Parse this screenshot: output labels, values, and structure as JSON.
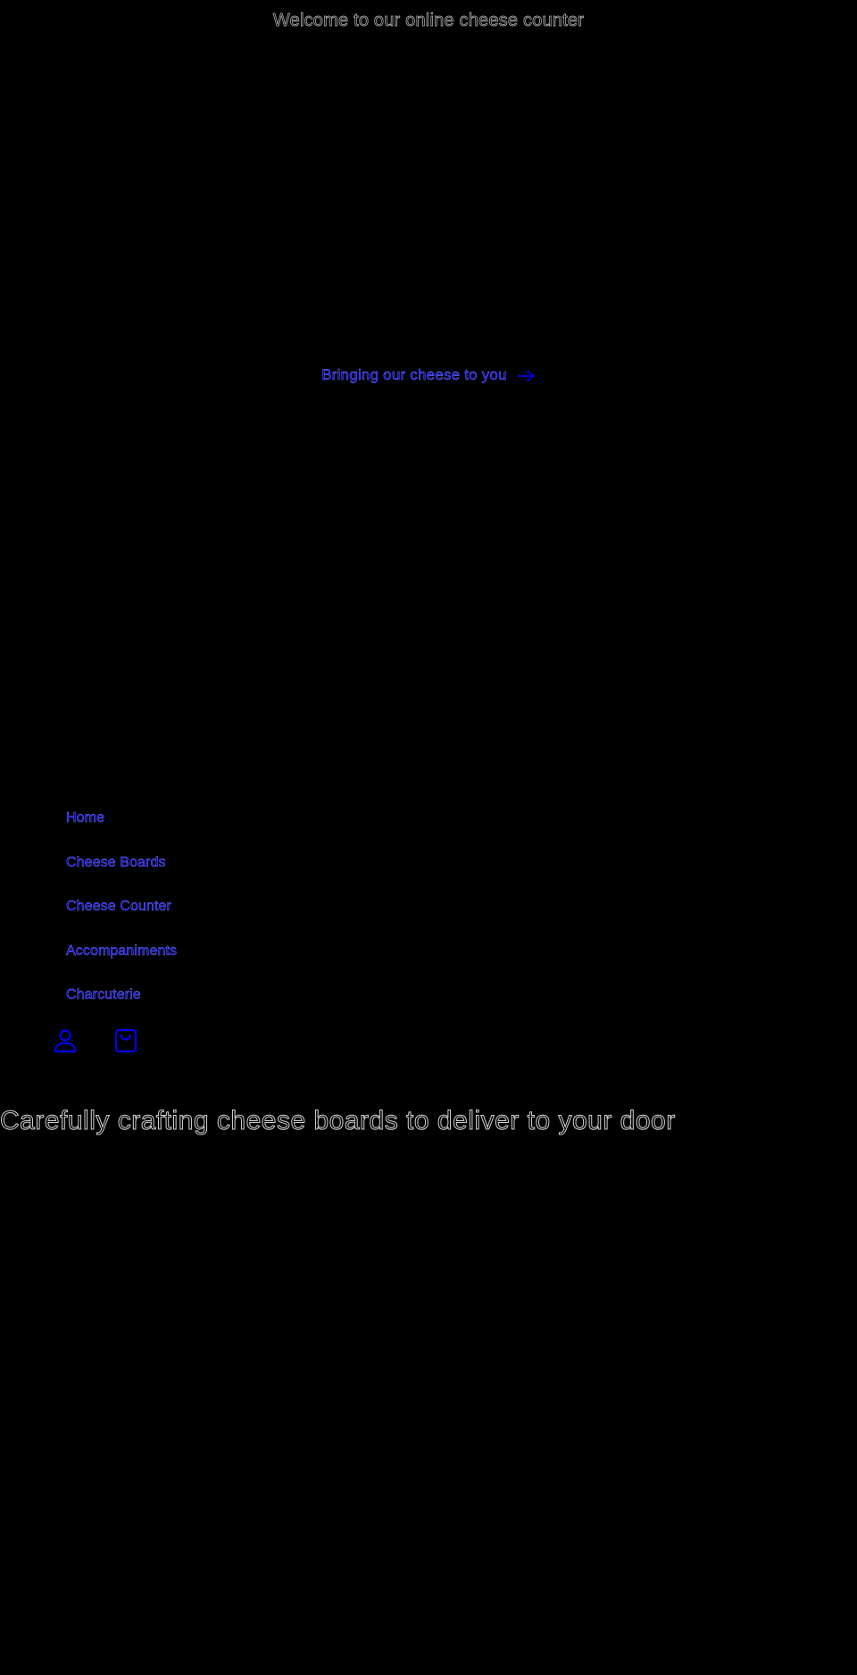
{
  "announcement": {
    "text": "Welcome to our online cheese counter"
  },
  "promo": {
    "link_text": "Bringing our cheese to you",
    "icon": "arrow-right-icon"
  },
  "nav": {
    "items": [
      {
        "label": "Home"
      },
      {
        "label": "Cheese Boards"
      },
      {
        "label": "Cheese Counter"
      },
      {
        "label": "Accompaniments"
      },
      {
        "label": "Charcuterie"
      }
    ]
  },
  "header_icons": [
    {
      "icon": "account-icon"
    },
    {
      "icon": "cart-icon"
    }
  ],
  "hero": {
    "heading": "Carefully crafting cheese boards to deliver to your door"
  },
  "colors": {
    "background": "#000000",
    "link": "#0000ee",
    "text_outline": "#bdbdbd"
  }
}
